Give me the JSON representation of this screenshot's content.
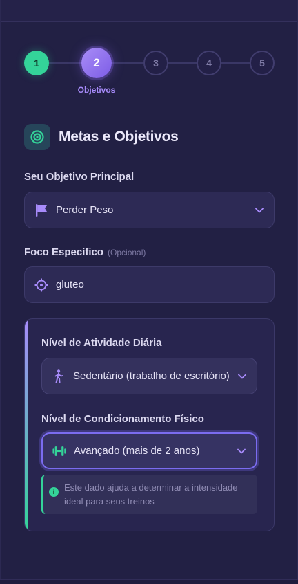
{
  "stepper": {
    "steps": [
      {
        "number": "1",
        "state": "done"
      },
      {
        "number": "2",
        "state": "active"
      },
      {
        "number": "3",
        "state": "todo"
      },
      {
        "number": "4",
        "state": "todo"
      },
      {
        "number": "5",
        "state": "todo"
      }
    ],
    "active_caption": "Objetivos"
  },
  "section": {
    "title": "Metas e Objetivos",
    "icon": "target-icon"
  },
  "main_goal": {
    "label": "Seu Objetivo Principal",
    "value": "Perder Peso",
    "icon": "flag-icon"
  },
  "focus": {
    "label": "Foco Específico",
    "optional_tag": "(Opcional)",
    "value": "gluteo",
    "icon": "crosshair-icon"
  },
  "activity": {
    "label": "Nível de Atividade Diária",
    "value": "Sedentário (trabalho de escritório)",
    "icon": "walking-icon"
  },
  "fitness": {
    "label": "Nível de Condicionamento Físico",
    "value": "Avançado (mais de 2 anos)",
    "icon": "dumbbell-icon",
    "hint": "Este dado ajuda a determinar a intensidade ideal para seus treinos"
  },
  "colors": {
    "background": "#222044",
    "accent_purple": "#a78bfa",
    "accent_green": "#34d399",
    "focus_ring": "#7b6cf0"
  }
}
